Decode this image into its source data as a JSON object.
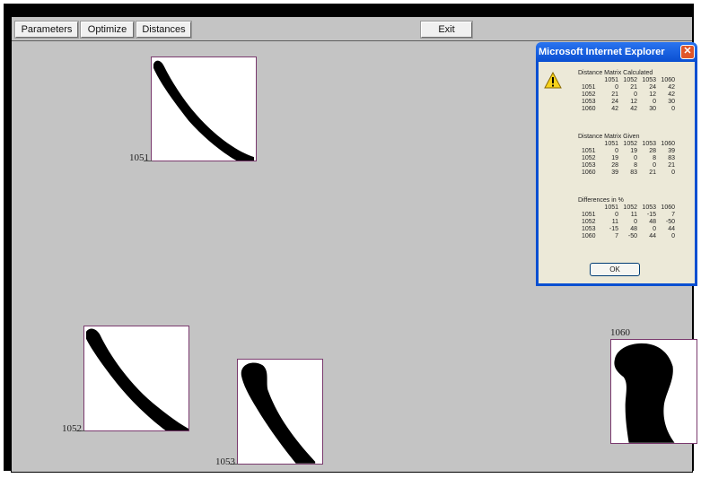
{
  "toolbar": {
    "parameters_label": "Parameters",
    "optimize_label": "Optimize",
    "distances_label": "Distances",
    "exit_label": "Exit"
  },
  "tiles": [
    {
      "label": "1051"
    },
    {
      "label": "1052"
    },
    {
      "label": "1053"
    },
    {
      "label": "1060"
    }
  ],
  "dialog": {
    "title": "Microsoft Internet Explorer",
    "close_glyph": "✕",
    "icon": "warning-icon",
    "ok_label": "OK",
    "matrices": [
      {
        "title": "Distance Matrix Calculated",
        "headers": [
          "",
          "1051",
          "1052",
          "1053",
          "1060"
        ],
        "rows": [
          [
            "1051",
            "0",
            "21",
            "24",
            "42"
          ],
          [
            "1052",
            "21",
            "0",
            "12",
            "42"
          ],
          [
            "1053",
            "24",
            "12",
            "0",
            "30"
          ],
          [
            "1060",
            "42",
            "42",
            "30",
            "0"
          ]
        ]
      },
      {
        "title": "Distance Matrix Given",
        "headers": [
          "",
          "1051",
          "1052",
          "1053",
          "1060"
        ],
        "rows": [
          [
            "1051",
            "0",
            "19",
            "28",
            "39"
          ],
          [
            "1052",
            "19",
            "0",
            "8",
            "83"
          ],
          [
            "1053",
            "28",
            "8",
            "0",
            "21"
          ],
          [
            "1060",
            "39",
            "83",
            "21",
            "0"
          ]
        ]
      },
      {
        "title": "Differences in %",
        "headers": [
          "",
          "1051",
          "1052",
          "1053",
          "1060"
        ],
        "rows": [
          [
            "1051",
            "0",
            "11",
            "-15",
            "7"
          ],
          [
            "1052",
            "11",
            "0",
            "48",
            "-50"
          ],
          [
            "1053",
            "-15",
            "48",
            "0",
            "44"
          ],
          [
            "1060",
            "7",
            "-50",
            "44",
            "0"
          ]
        ]
      }
    ]
  },
  "colors": {
    "canvas_bg": "#c4c4c4",
    "tile_border": "#7a3a6e",
    "dialog_title": "#0a4fd1",
    "dialog_body": "#ece9d8"
  }
}
